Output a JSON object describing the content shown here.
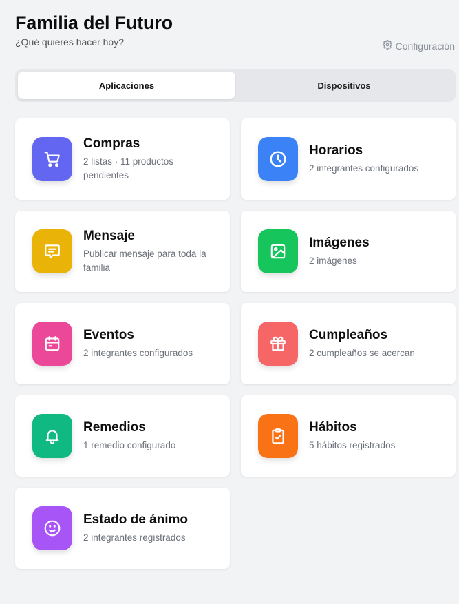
{
  "header": {
    "title": "Familia del Futuro",
    "subtitle": "¿Qué quieres hacer hoy?",
    "settings_label": "Configuración"
  },
  "tabs": [
    {
      "label": "Aplicaciones",
      "active": true
    },
    {
      "label": "Dispositivos",
      "active": false
    }
  ],
  "cards": [
    {
      "title": "Compras",
      "subtitle": "2 listas · 11 productos pendientes",
      "color": "#6366f1",
      "icon": "cart-icon"
    },
    {
      "title": "Horarios",
      "subtitle": "2 integrantes configurados",
      "color": "#3b82f6",
      "icon": "clock-icon"
    },
    {
      "title": "Mensaje",
      "subtitle": "Publicar mensaje para toda la familia",
      "color": "#eab308",
      "icon": "message-icon"
    },
    {
      "title": "Imágenes",
      "subtitle": "2 imágenes",
      "color": "#16c55c",
      "icon": "image-icon"
    },
    {
      "title": "Eventos",
      "subtitle": "2 integrantes configurados",
      "color": "#ec4899",
      "icon": "calendar-icon"
    },
    {
      "title": "Cumpleaños",
      "subtitle": "2 cumpleaños se acercan",
      "color": "#f76666",
      "icon": "gift-icon"
    },
    {
      "title": "Remedios",
      "subtitle": "1 remedio configurado",
      "color": "#10b981",
      "icon": "bell-icon"
    },
    {
      "title": "Hábitos",
      "subtitle": "5 hábitos registrados",
      "color": "#f97316",
      "icon": "clipboard-check-icon"
    },
    {
      "title": "Estado de ánimo",
      "subtitle": "2 integrantes registrados",
      "color": "#a855f7",
      "icon": "smile-icon"
    }
  ]
}
